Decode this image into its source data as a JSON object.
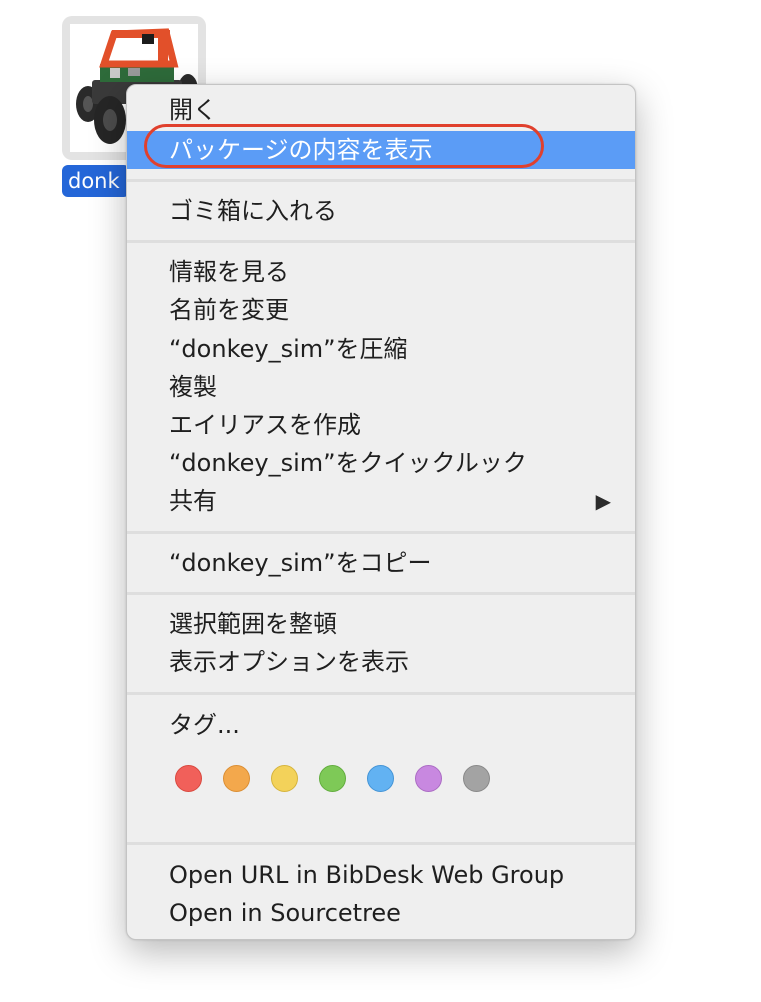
{
  "desktop": {
    "file_label": "donk"
  },
  "menu": {
    "items": [
      "開く",
      "パッケージの内容を表示",
      "ゴミ箱に入れる",
      "情報を見る",
      "名前を変更",
      "“donkey_sim”を圧縮",
      "複製",
      "エイリアスを作成",
      "“donkey_sim”をクイックルック",
      "共有",
      "“donkey_sim”をコピー",
      "選択範囲を整頓",
      "表示オプションを表示",
      "タグ...",
      "Open URL in BibDesk Web Group",
      "Open in Sourcetree"
    ],
    "highlighted_index": 1,
    "highlight_color": "#5b9cf6",
    "annotation_color": "#e0402d",
    "submenu_arrow": "▶",
    "tag_colors": [
      {
        "name": "red",
        "fill": "#f1605a",
        "border": "#d9493f"
      },
      {
        "name": "orange",
        "fill": "#f3a84c",
        "border": "#db8e34"
      },
      {
        "name": "yellow",
        "fill": "#f3d25a",
        "border": "#d6b43c"
      },
      {
        "name": "green",
        "fill": "#7ec957",
        "border": "#62ad3e"
      },
      {
        "name": "blue",
        "fill": "#62b2f2",
        "border": "#4494d6"
      },
      {
        "name": "purple",
        "fill": "#c888e0",
        "border": "#ab6cc4"
      },
      {
        "name": "gray",
        "fill": "#a3a3a3",
        "border": "#898989"
      }
    ]
  }
}
